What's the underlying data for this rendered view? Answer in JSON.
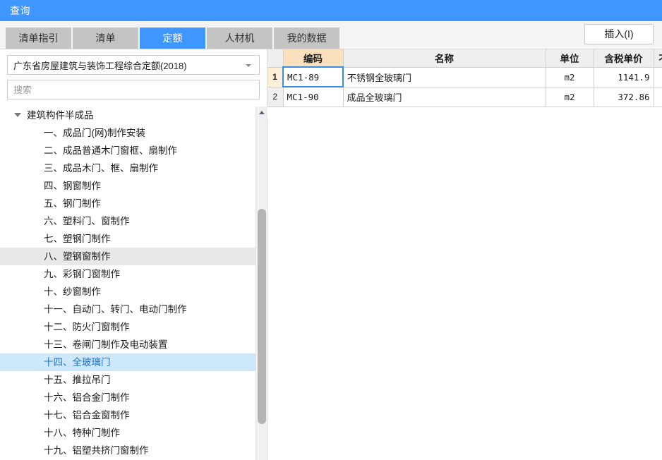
{
  "window": {
    "title": "查询"
  },
  "tabs": [
    {
      "label": "清单指引",
      "active": false
    },
    {
      "label": "清单",
      "active": false
    },
    {
      "label": "定额",
      "active": true
    },
    {
      "label": "人材机",
      "active": false
    },
    {
      "label": "我的数据",
      "active": false
    }
  ],
  "toolbar": {
    "insert_label": "插入(I)"
  },
  "left_panel": {
    "library_select": {
      "value": "广东省房屋建筑与装饰工程综合定额(2018)"
    },
    "search": {
      "value": "",
      "placeholder": "搜索"
    },
    "tree": [
      {
        "label": "建筑构件半成品",
        "level": 0,
        "expanded": true,
        "state": "normal"
      },
      {
        "label": "一、成品门(网)制作安装",
        "level": 1,
        "state": "normal"
      },
      {
        "label": "二、成品普通木门窗框、扇制作",
        "level": 1,
        "state": "normal"
      },
      {
        "label": "三、成品木门、框、扇制作",
        "level": 1,
        "state": "normal"
      },
      {
        "label": "四、钢窗制作",
        "level": 1,
        "state": "normal"
      },
      {
        "label": "五、钢门制作",
        "level": 1,
        "state": "normal"
      },
      {
        "label": "六、塑料门、窗制作",
        "level": 1,
        "state": "normal"
      },
      {
        "label": "七、塑钢门制作",
        "level": 1,
        "state": "normal"
      },
      {
        "label": "八、塑钢窗制作",
        "level": 1,
        "state": "hover"
      },
      {
        "label": "九、彩钢门窗制作",
        "level": 1,
        "state": "normal"
      },
      {
        "label": "十、纱窗制作",
        "level": 1,
        "state": "normal"
      },
      {
        "label": "十一、自动门、转门、电动门制作",
        "level": 1,
        "state": "normal"
      },
      {
        "label": "十二、防火门窗制作",
        "level": 1,
        "state": "normal"
      },
      {
        "label": "十三、卷闸门制作及电动装置",
        "level": 1,
        "state": "normal"
      },
      {
        "label": "十四、全玻璃门",
        "level": 1,
        "state": "selected"
      },
      {
        "label": "十五、推拉吊门",
        "level": 1,
        "state": "normal"
      },
      {
        "label": "十六、铝合金门制作",
        "level": 1,
        "state": "normal"
      },
      {
        "label": "十七、铝合金窗制作",
        "level": 1,
        "state": "normal"
      },
      {
        "label": "十八、特种门制作",
        "level": 1,
        "state": "normal"
      },
      {
        "label": "十九、铝塑共挤门窗制作",
        "level": 1,
        "state": "normal"
      }
    ]
  },
  "grid": {
    "columns": [
      {
        "key": "gutter",
        "label": "",
        "highlight": false
      },
      {
        "key": "code",
        "label": "编码",
        "highlight": true
      },
      {
        "key": "name",
        "label": "名称",
        "highlight": false
      },
      {
        "key": "unit",
        "label": "单位",
        "highlight": false
      },
      {
        "key": "price",
        "label": "含税单价",
        "highlight": false
      },
      {
        "key": "tail",
        "label": "不",
        "highlight": false
      }
    ],
    "rows": [
      {
        "num": "1",
        "code": "MC1-89",
        "name": "不锈钢全玻璃门",
        "unit": "m2",
        "price": "1141.9",
        "tail": "",
        "active": true
      },
      {
        "num": "2",
        "code": "MC1-90",
        "name": "成品全玻璃门",
        "unit": "m2",
        "price": "372.86",
        "tail": "",
        "active": false
      }
    ]
  },
  "colors": {
    "title_bar": "#4096ff",
    "tab_active": "#4096ff",
    "tab_inactive": "#c4c4c4",
    "tree_selected_bg": "#cce8fa",
    "tree_selected_text": "#1f6fd0",
    "header_highlight": "#fae0bd",
    "row_gutter_active": "#fdeed8"
  }
}
